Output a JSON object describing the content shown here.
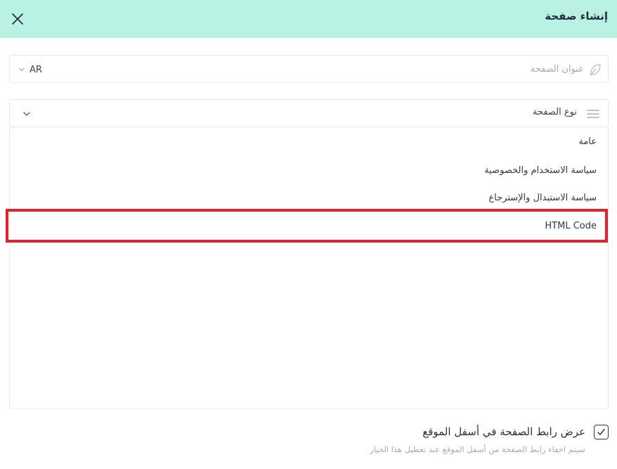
{
  "header": {
    "title": "إنشاء صفحة",
    "close_icon": "close-icon",
    "background": "#b9f1e3"
  },
  "title_field": {
    "placeholder": "عنوان الصفحة",
    "value": "",
    "icon": "feather-icon",
    "language": {
      "selected": "AR",
      "icon": "chevron-down-icon"
    }
  },
  "page_type": {
    "label": "نوع الصفحة",
    "icon": "list-icon",
    "chevron_icon": "chevron-down-icon",
    "options": [
      {
        "label": "عامة"
      },
      {
        "label": "سياسة الاستخدام والخصوصية"
      },
      {
        "label": "سياسة الاستبدال والإسترجاع"
      },
      {
        "label": "HTML Code"
      }
    ],
    "highlighted_option": "HTML Code",
    "highlight_color": "#e3212b"
  },
  "footer_link": {
    "checked": true,
    "label": "عرض رابط الصفحة في أسفل الموقع",
    "hint": "سيتم اخفاء رابط الصفحة من أسفل الموقع عند تعطيل هذا الخيار"
  }
}
